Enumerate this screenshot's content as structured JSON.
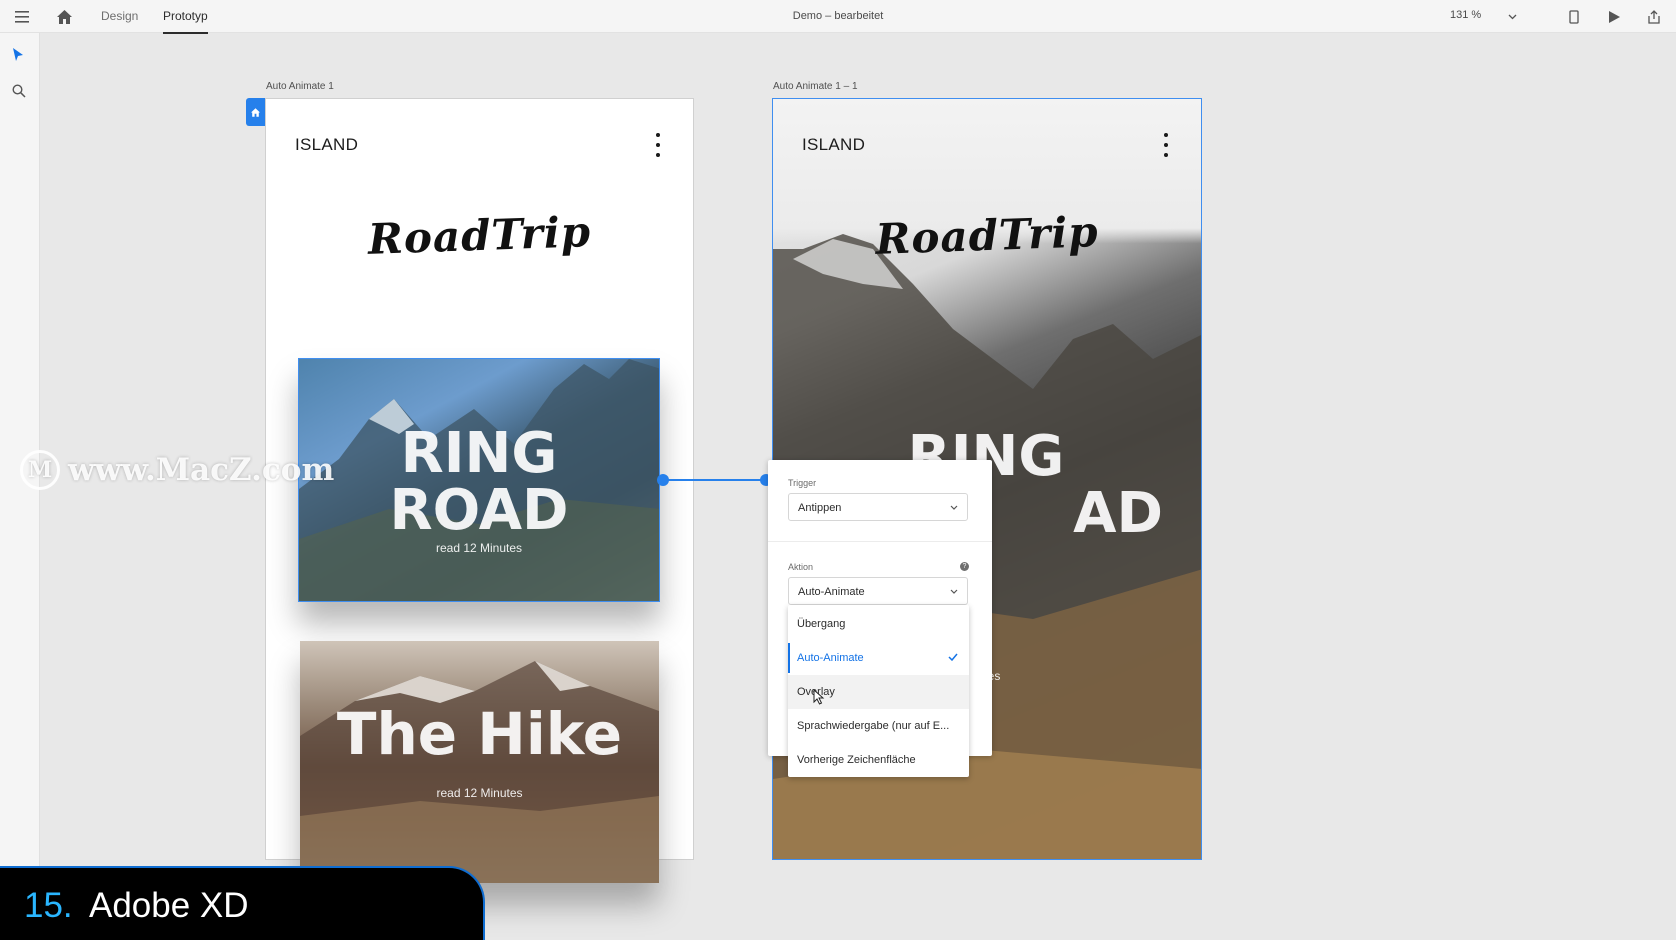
{
  "toolbar": {
    "tabs": [
      "Design",
      "Prototyp"
    ],
    "active_tab": "Prototyp",
    "document_title": "Demo – bearbeitet",
    "zoom": "131 %"
  },
  "artboards": [
    {
      "label": "Auto Animate 1",
      "title": "ISLAND",
      "logo": "RoadTrip"
    },
    {
      "label": "Auto Animate 1 – 1",
      "title": "ISLAND",
      "logo": "RoadTrip"
    }
  ],
  "cards": {
    "ring": {
      "line1": "RING",
      "line2": "ROAD",
      "sub": "read 12 Minutes"
    },
    "hike": {
      "title": "The Hike",
      "sub": "read 12 Minutes"
    },
    "ring_partial": {
      "line1": "RING",
      "line2": "AD",
      "sub": "nutes"
    }
  },
  "prototype_panel": {
    "trigger_label": "Trigger",
    "trigger_value": "Antippen",
    "action_label": "Aktion",
    "action_value": "Auto-Animate",
    "options": [
      "Übergang",
      "Auto-Animate",
      "Overlay",
      "Sprachwiedergabe (nur auf E...",
      "Vorherige Zeichenfläche"
    ],
    "selected_option": "Auto-Animate",
    "hovered_option": "Overlay"
  },
  "watermark": "www.MacZ.com",
  "banner": {
    "number": "15.",
    "text": "Adobe XD"
  },
  "colors": {
    "accent": "#2680eb",
    "selected": "#1473e6",
    "banner_num": "#2ab6ff"
  }
}
